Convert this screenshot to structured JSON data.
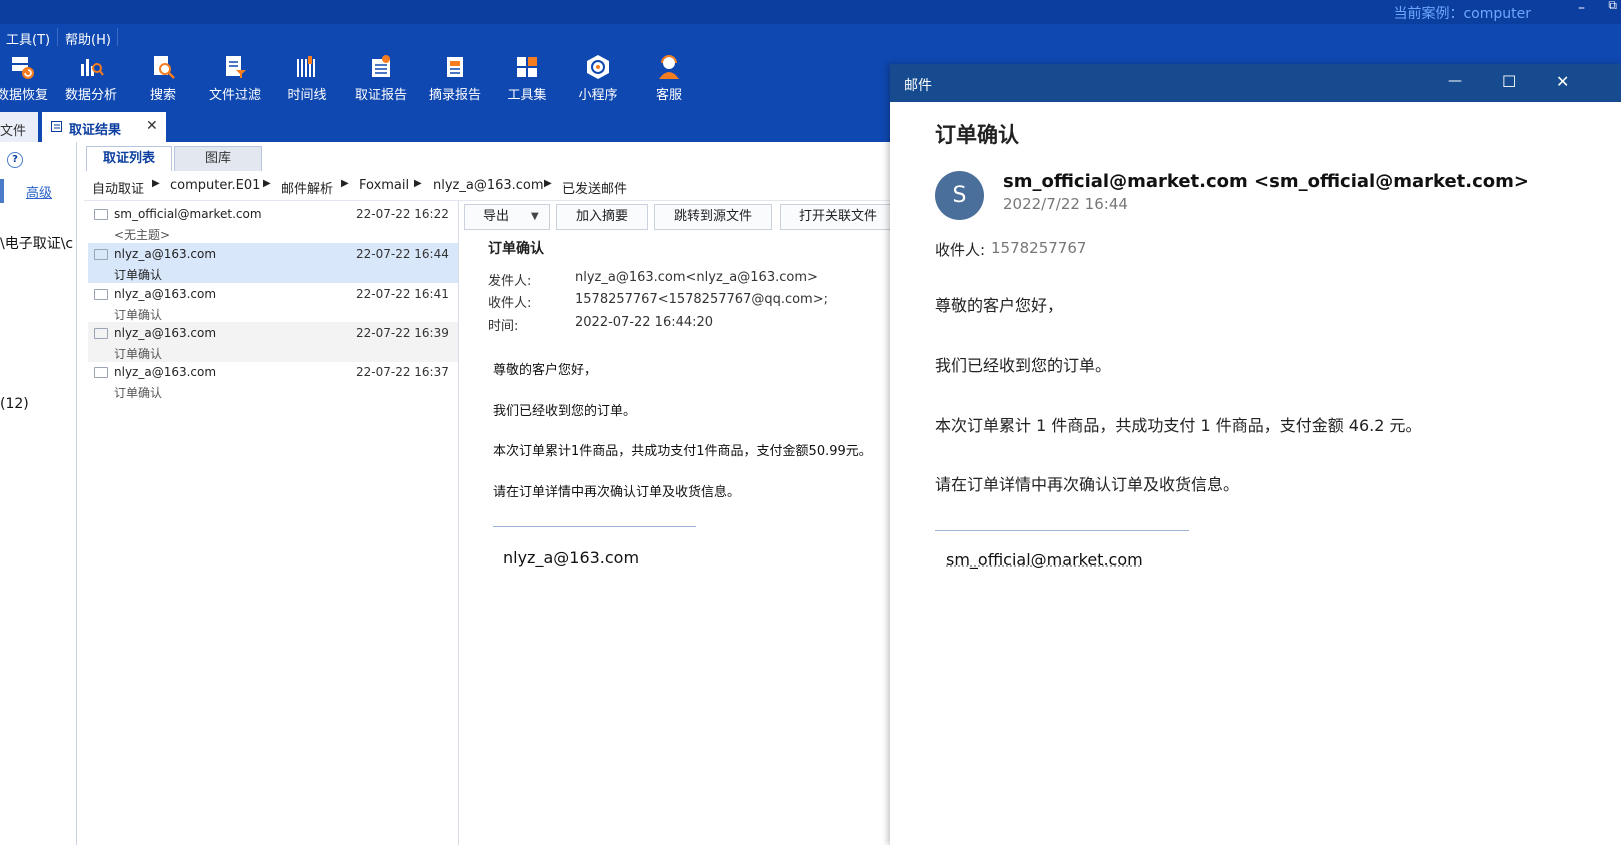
{
  "titlebar": {
    "case_label": "当前案例：computer",
    "minimize": "–",
    "restore": "⧉"
  },
  "menu": {
    "items": [
      "工具(T)",
      "帮助(H)"
    ]
  },
  "toolbar": {
    "items": [
      {
        "label": "数据恢复",
        "icon": "data-recovery-icon"
      },
      {
        "label": "数据分析",
        "icon": "data-analysis-icon"
      },
      {
        "label": "搜索",
        "icon": "search-icon"
      },
      {
        "label": "文件过滤",
        "icon": "file-filter-icon"
      },
      {
        "label": "时间线",
        "icon": "timeline-icon"
      },
      {
        "label": "取证报告",
        "icon": "forensic-report-icon"
      },
      {
        "label": "摘录报告",
        "icon": "excerpt-report-icon"
      },
      {
        "label": "工具集",
        "icon": "toolkit-icon"
      },
      {
        "label": "小程序",
        "icon": "mini-program-icon"
      },
      {
        "label": "客服",
        "icon": "customer-service-icon"
      }
    ]
  },
  "doc_tabs": {
    "files": "文件",
    "results": "取证结果",
    "close": "✕"
  },
  "left_panel": {
    "help": "?",
    "advanced": "高级",
    "path_fragment": "\\电子取证\\c",
    "count": "(12)"
  },
  "subtabs": {
    "list": "取证列表",
    "gallery": "图库"
  },
  "breadcrumb": [
    "自动取证",
    "computer.E01",
    "邮件解析",
    "Foxmail",
    "nlyz_a@163.com",
    "已发送邮件"
  ],
  "mail_list": [
    {
      "from": "sm_official@market.com",
      "date": "22-07-22 16:22",
      "subject": "<无主题>"
    },
    {
      "from": "nlyz_a@163.com",
      "date": "22-07-22 16:44",
      "subject": "订单确认"
    },
    {
      "from": "nlyz_a@163.com",
      "date": "22-07-22 16:41",
      "subject": "订单确认"
    },
    {
      "from": "nlyz_a@163.com",
      "date": "22-07-22 16:39",
      "subject": "订单确认"
    },
    {
      "from": "nlyz_a@163.com",
      "date": "22-07-22 16:37",
      "subject": "订单确认"
    }
  ],
  "preview": {
    "buttons": {
      "export": "导出",
      "add_excerpt": "加入摘要",
      "jump_source": "跳转到源文件",
      "open_related": "打开关联文件"
    },
    "subject": "订单确认",
    "sender_label": "发件人:",
    "sender": "nlyz_a@163.com<nlyz_a@163.com>",
    "recipient_label": "收件人:",
    "recipient": "1578257767<1578257767@qq.com>;",
    "time_label": "时间:",
    "time": "2022-07-22 16:44:20",
    "body": [
      "尊敬的客户您好，",
      "我们已经收到您的订单。",
      "本次订单累计1件商品，共成功支付1件商品，支付金额50.99元。",
      "请在订单详情中再次确认订单及收货信息。"
    ],
    "signature": "nlyz_a@163.com"
  },
  "mail_window": {
    "title": "邮件",
    "subject": "订单确认",
    "avatar_letter": "S",
    "sender": "sm_official@market.com <sm_official@market.com>",
    "date": "2022/7/22 16:44",
    "recipient_label": "收件人:",
    "recipient": "1578257767",
    "body": [
      "尊敬的客户您好，",
      "我们已经收到您的订单。",
      "本次订单累计 1 件商品，共成功支付 1 件商品，支付金额 46.2 元。",
      "请在订单详情中再次确认订单及收货信息。"
    ],
    "signature": "sm_official@market.com",
    "controls": {
      "minimize": "—",
      "maximize": "☐",
      "close": "✕"
    }
  },
  "colors": {
    "titlebar": "#0b3e9e",
    "toolbar": "#0f48b0",
    "mail_window_title": "#164c8f",
    "avatar": "#4a6f9a",
    "selected_row": "#d9e7fa"
  }
}
